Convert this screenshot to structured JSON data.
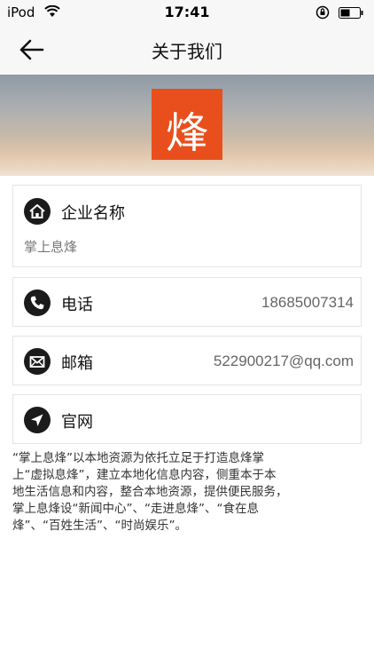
{
  "status_bar": {
    "carrier": "iPod",
    "time": "17:41"
  },
  "nav": {
    "title": "关于我们"
  },
  "logo": {
    "glyph": "烽",
    "color": "#e94f1d"
  },
  "company": {
    "label": "企业名称",
    "value": "掌上息烽"
  },
  "phone": {
    "label": "电话",
    "value": "18685007314"
  },
  "email": {
    "label": "邮箱",
    "value": "522900217@qq.com"
  },
  "website": {
    "label": "官网"
  },
  "description": "“掌上息烽”以本地资源为依托立足于打造息烽掌\n上“虚拟息烽”，建立本地化信息内容，侧重本于本\n地生活信息和内容，整合本地资源，提供便民服务，\n掌上息烽设“新闻中心”、“走进息烽”、“食在息\n烽”、“百姓生活”、“时尚娱乐”。"
}
